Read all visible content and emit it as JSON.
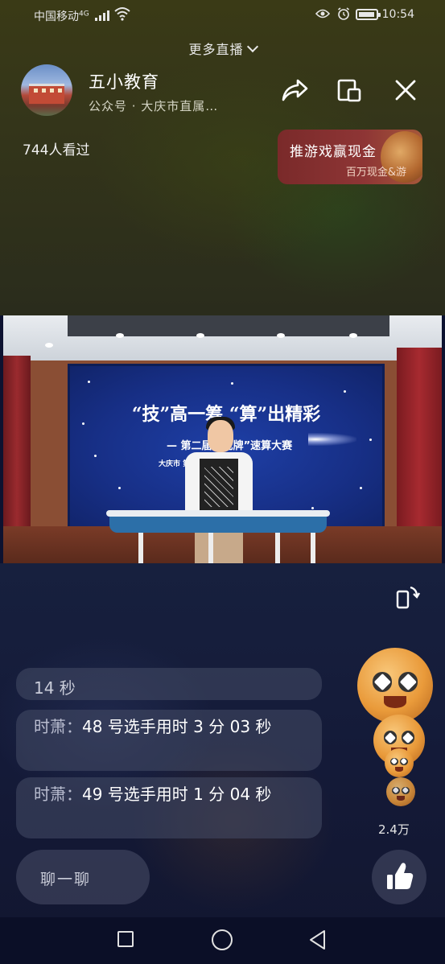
{
  "status_bar": {
    "carrier": "中国移动",
    "network": "4G",
    "time": "10:54"
  },
  "header": {
    "more_live": "更多直播",
    "account_name": "五小教育",
    "account_sub": "公众号 · 大庆市直属…",
    "viewers": "744人看过"
  },
  "promo": {
    "title": "推游戏赢现金",
    "subtitle": "百万现金&游"
  },
  "video": {
    "screen_title": "“技”高一筹  “算”出精彩",
    "screen_subtitle": "— 第二届“  克牌”速算大赛",
    "screen_school": "大庆市    第五小学校"
  },
  "comments": [
    {
      "user": "",
      "text": "14 秒"
    },
    {
      "user": "时萧：",
      "text": "48 号选手用时 3 分 03 秒"
    },
    {
      "user": "时萧：",
      "text": "49 号选手用时 1 分 04 秒"
    }
  ],
  "likes_count": "2.4万",
  "input": {
    "placeholder": "聊一聊"
  },
  "icons": {
    "share": "share-icon",
    "float": "float-window-icon",
    "close": "close-icon",
    "rotate": "rotate-screen-icon",
    "like": "thumbs-up-icon"
  }
}
